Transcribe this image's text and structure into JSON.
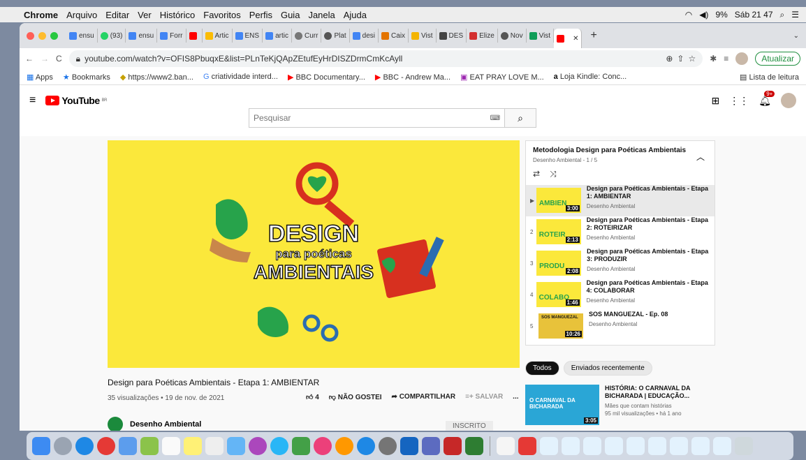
{
  "menubar": {
    "app": "Chrome",
    "items": [
      "Arquivo",
      "Editar",
      "Ver",
      "Histórico",
      "Favoritos",
      "Perfis",
      "Guia",
      "Janela",
      "Ajuda"
    ],
    "battery": "9%",
    "clock": "Sáb 21 47"
  },
  "tabs": [
    "ensu",
    "(93)",
    "ensu",
    "Forr",
    "",
    "Artic",
    "ENS",
    "artic",
    "Curr",
    "Plat",
    "desi",
    "Caix",
    "Vist",
    "DES",
    "Elize",
    "Nov",
    "Vist",
    ""
  ],
  "url": "youtube.com/watch?v=OFIS8PbuqxE&list=PLnTeKjQApZEtufEyHrDISZDrmCmKcAyll",
  "update_label": "Atualizar",
  "bookmarks": [
    "Apps",
    "Bookmarks",
    "https://www2.ban...",
    "criatividade interd...",
    "BBC Documentary...",
    "BBC - Andrew Ma...",
    "EAT PRAY LOVE M...",
    "Loja Kindle: Conc...",
    "Lista de leitura"
  ],
  "youtube": {
    "logo": "YouTube",
    "region": "BR",
    "search_placeholder": "Pesquisar",
    "notifications": "9+"
  },
  "video": {
    "title": "Design para Poéticas Ambientais - Etapa 1: AMBIENTAR",
    "meta": "35 visualizações • 19 de nov. de 2021",
    "likes": "4",
    "dislike": "NÃO GOSTEI",
    "share": "COMPARTILHAR",
    "save": "SALVAR",
    "more": "...",
    "channel": "Desenho Ambiental",
    "subscribe": "INSCRITO",
    "thumb_line1": "DESIGN",
    "thumb_line2": "para poéticas",
    "thumb_line3": "AMBIENTAIS"
  },
  "playlist": {
    "title": "Metodologia Design para Poéticas Ambientais",
    "subtitle": "Desenho Ambiental - 1 / 5",
    "items": [
      {
        "idx": "▶",
        "word": "AMBIEN",
        "duration": "3:00",
        "title": "Design para Poéticas Ambientais - Etapa 1: AMBIENTAR",
        "channel": "Desenho Ambiental"
      },
      {
        "idx": "2",
        "word": "ROTEIR",
        "duration": "2:13",
        "title": "Design para Poéticas Ambientais - Etapa 2: ROTEIRIZAR",
        "channel": "Desenho Ambiental"
      },
      {
        "idx": "3",
        "word": "PRODU",
        "duration": "2:08",
        "title": "Design para Poéticas Ambientais - Etapa 3: PRODUZIR",
        "channel": "Desenho Ambiental"
      },
      {
        "idx": "4",
        "word": "COLABO",
        "duration": "1:46",
        "title": "Design para Poéticas Ambientais - Etapa 4: COLABORAR",
        "channel": "Desenho Ambiental"
      },
      {
        "idx": "5",
        "word": "SOS MANGUEZAL",
        "duration": "10:26",
        "title": "SOS MANGUEZAL - Ep. 08",
        "channel": "Desenho Ambiental"
      }
    ]
  },
  "chips": [
    "Todos",
    "Enviados recentemente"
  ],
  "recommended": {
    "title": "HISTÓRIA: O CARNAVAL DA BICHARADA | EDUCAÇÃO...",
    "channel": "Mães que contam histórias",
    "meta": "95 mil visualizações • há 1 ano",
    "duration": "3:05",
    "thumb_text": "O CARNAVAL DA BICHARADA"
  },
  "colors": {
    "yt_red": "#ff0000",
    "thumb_yellow": "#fbe83b",
    "green": "#27a34b"
  }
}
